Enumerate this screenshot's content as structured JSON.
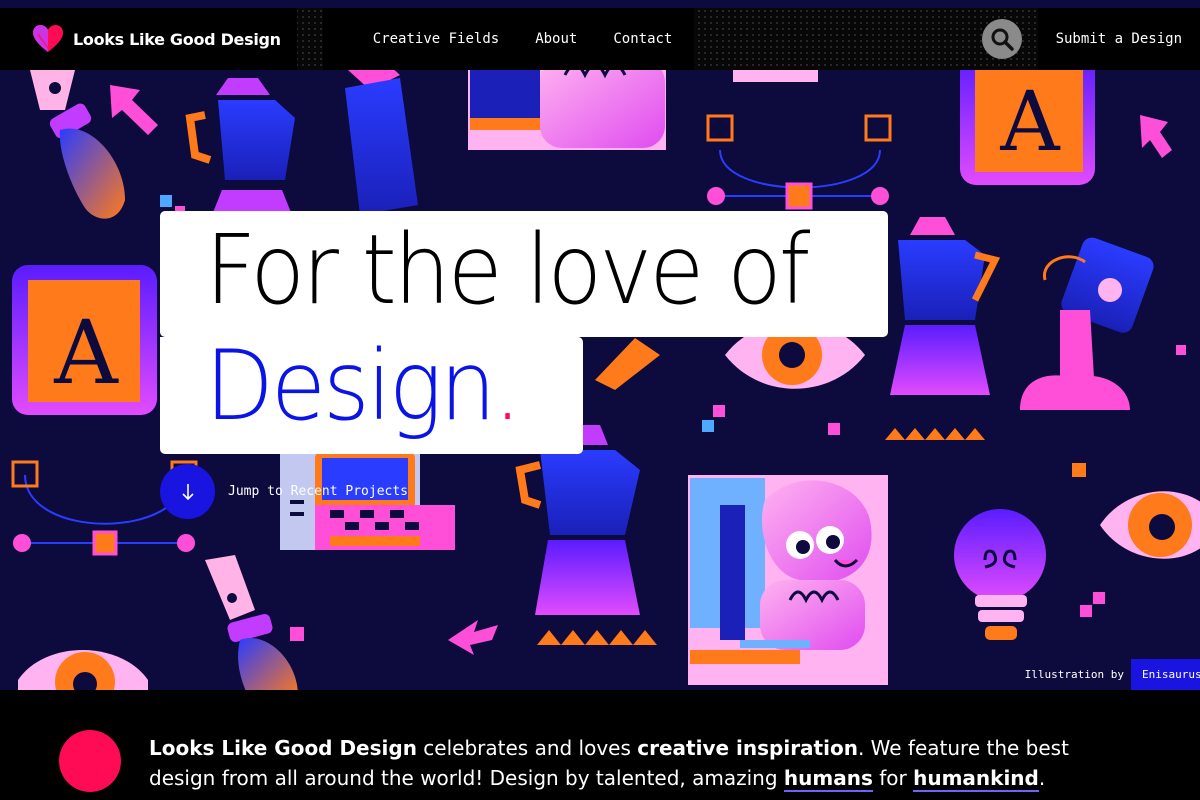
{
  "nav": {
    "logo_text": "Looks Like Good Design",
    "links": [
      "Creative Fields",
      "About",
      "Contact"
    ],
    "submit_label": "Submit a Design"
  },
  "hero": {
    "headline_line1": "For the love of",
    "headline_line2": "Design",
    "headline_dot": ".",
    "jump_label": "Jump to Recent Projects",
    "credit_label": "Illustration by",
    "credit_name": "Enisaurus"
  },
  "intro": {
    "brand": "Looks Like Good Design",
    "t1": " celebrates and loves ",
    "inspiration": "creative inspiration",
    "t2": ". We feature the best design from all around the world! Design by talented, amazing ",
    "humans": "humans",
    "t3": " for ",
    "humankind": "humankind",
    "t4": "."
  },
  "colors": {
    "hero_bg": "#0d0a3d",
    "accent_blue": "#1a14e0",
    "accent_pink": "#ff0a54",
    "accent_orange": "#ff7a1a",
    "accent_purple": "#c23cff"
  },
  "icons": {
    "logo": "heart-icon",
    "search": "search-icon",
    "jump": "arrow-down-icon"
  }
}
